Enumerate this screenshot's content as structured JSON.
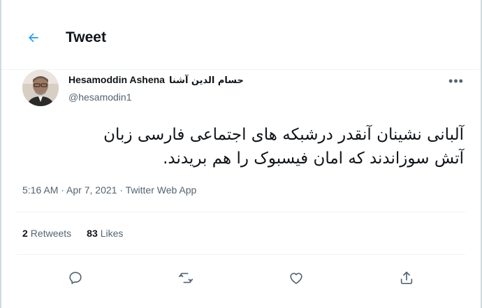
{
  "header": {
    "back_icon": "arrow-left-icon",
    "title": "Tweet"
  },
  "author": {
    "name": "Hesamoddin Ashena",
    "name_fa": "حسام الدین آشنا",
    "handle": "@hesamodin1",
    "avatar_icon": "avatar-photo",
    "more_icon": "more-dots-icon"
  },
  "tweet": {
    "text_line1": "آلبانی نشینان آنقدر درشبکه های اجتماعی فارسی زبان",
    "text_line2": "آتش سوزاندند که امان فیسبوک را هم بریدند."
  },
  "meta": {
    "time": "5:16 AM",
    "separator1": " · ",
    "date": "Apr 7, 2021",
    "separator2": " · ",
    "source": "Twitter Web App"
  },
  "stats": {
    "retweets_count": "2",
    "retweets_label": "Retweets",
    "likes_count": "83",
    "likes_label": "Likes"
  },
  "actions": {
    "reply_icon": "reply-icon",
    "retweet_icon": "retweet-icon",
    "like_icon": "heart-icon",
    "share_icon": "share-icon"
  },
  "colors": {
    "accent": "#1d9bf0",
    "text_primary": "#0f1419",
    "text_secondary": "#536471",
    "divider": "#eff3f4"
  }
}
